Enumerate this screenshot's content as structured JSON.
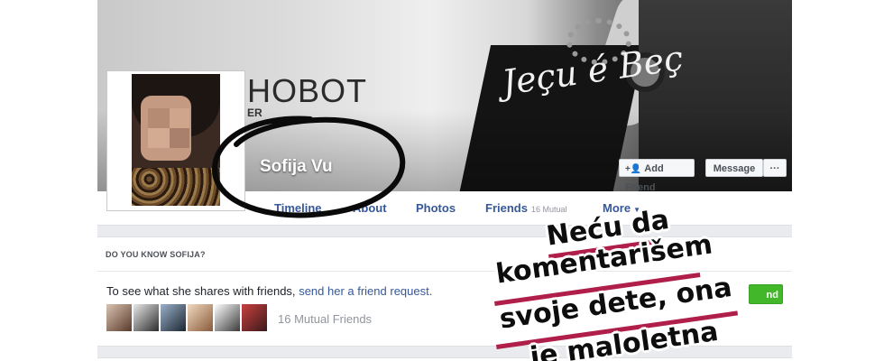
{
  "cover": {
    "brand_text": "HOBOT",
    "brand_sub": "ER",
    "shirt_text": "Jeçu é Beç"
  },
  "profile": {
    "name": "Sofija Vu"
  },
  "actions": {
    "add_friend_label": "Add Friend",
    "message_label": "Message",
    "more_label": "···"
  },
  "tabs": {
    "timeline": "Timeline",
    "about": "About",
    "photos": "Photos",
    "friends": "Friends",
    "friends_mutual": "16 Mutual",
    "more": "More"
  },
  "know": {
    "title": "DO YOU KNOW SOFIJA?",
    "text_prefix": "To see what she shares with friends,",
    "link_text": "send her a friend request.",
    "mutual_friends": "16 Mutual Friends",
    "button_fragment": "nd"
  },
  "caption": {
    "line1": "Neću da",
    "line2": "komentarišem",
    "line3": "svoje dete, ona",
    "line4": "je maloletna"
  },
  "colors": {
    "link": "#365899",
    "green": "#42b72a",
    "caption_accent": "#b01e4a"
  }
}
